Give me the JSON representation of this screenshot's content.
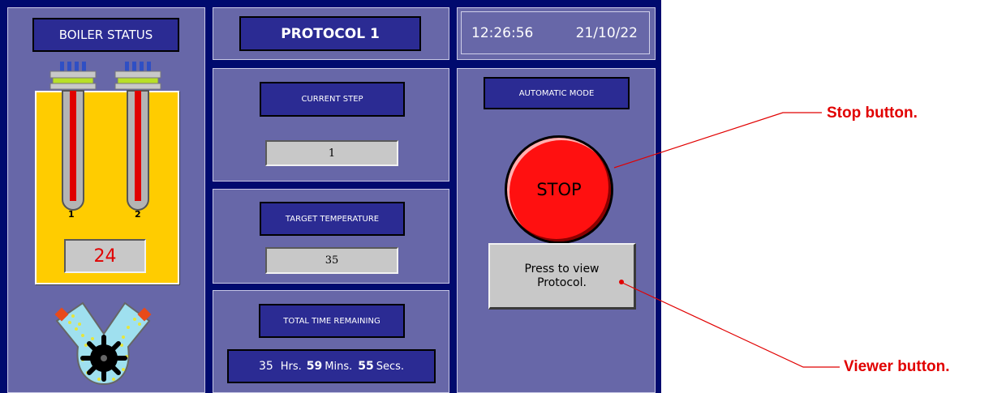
{
  "boiler": {
    "title": "BOILER STATUS",
    "heater_labels": [
      "1",
      "2"
    ],
    "temperature": "24"
  },
  "protocol": {
    "title": "PROTOCOL 1"
  },
  "clock": {
    "time": "12:26:56",
    "date": "21/10/22"
  },
  "current_step": {
    "label": "CURRENT STEP",
    "value": "1"
  },
  "target_temperature": {
    "label": "TARGET TEMPERATURE",
    "value": "35"
  },
  "time_remaining": {
    "label": "TOTAL TIME REMAINING",
    "hours": "35",
    "hours_unit": "Hrs.",
    "minutes": "59",
    "minutes_unit": "Mins.",
    "seconds": "55",
    "seconds_unit": "Secs."
  },
  "control": {
    "mode": "AUTOMATIC MODE",
    "stop_label": "STOP",
    "view_protocol_label": "Press to view Protocol."
  },
  "annotations": {
    "stop": "Stop button.",
    "viewer": "Viewer button."
  },
  "colors": {
    "background": "#000a6e",
    "panel": "#6767a8",
    "label_box": "#2b2b93",
    "stop_button": "#ff0000",
    "boiler_tank": "#ffcc00",
    "annotation": "#e10000"
  },
  "icons": [
    "heating-element-icon",
    "pump-icon"
  ]
}
